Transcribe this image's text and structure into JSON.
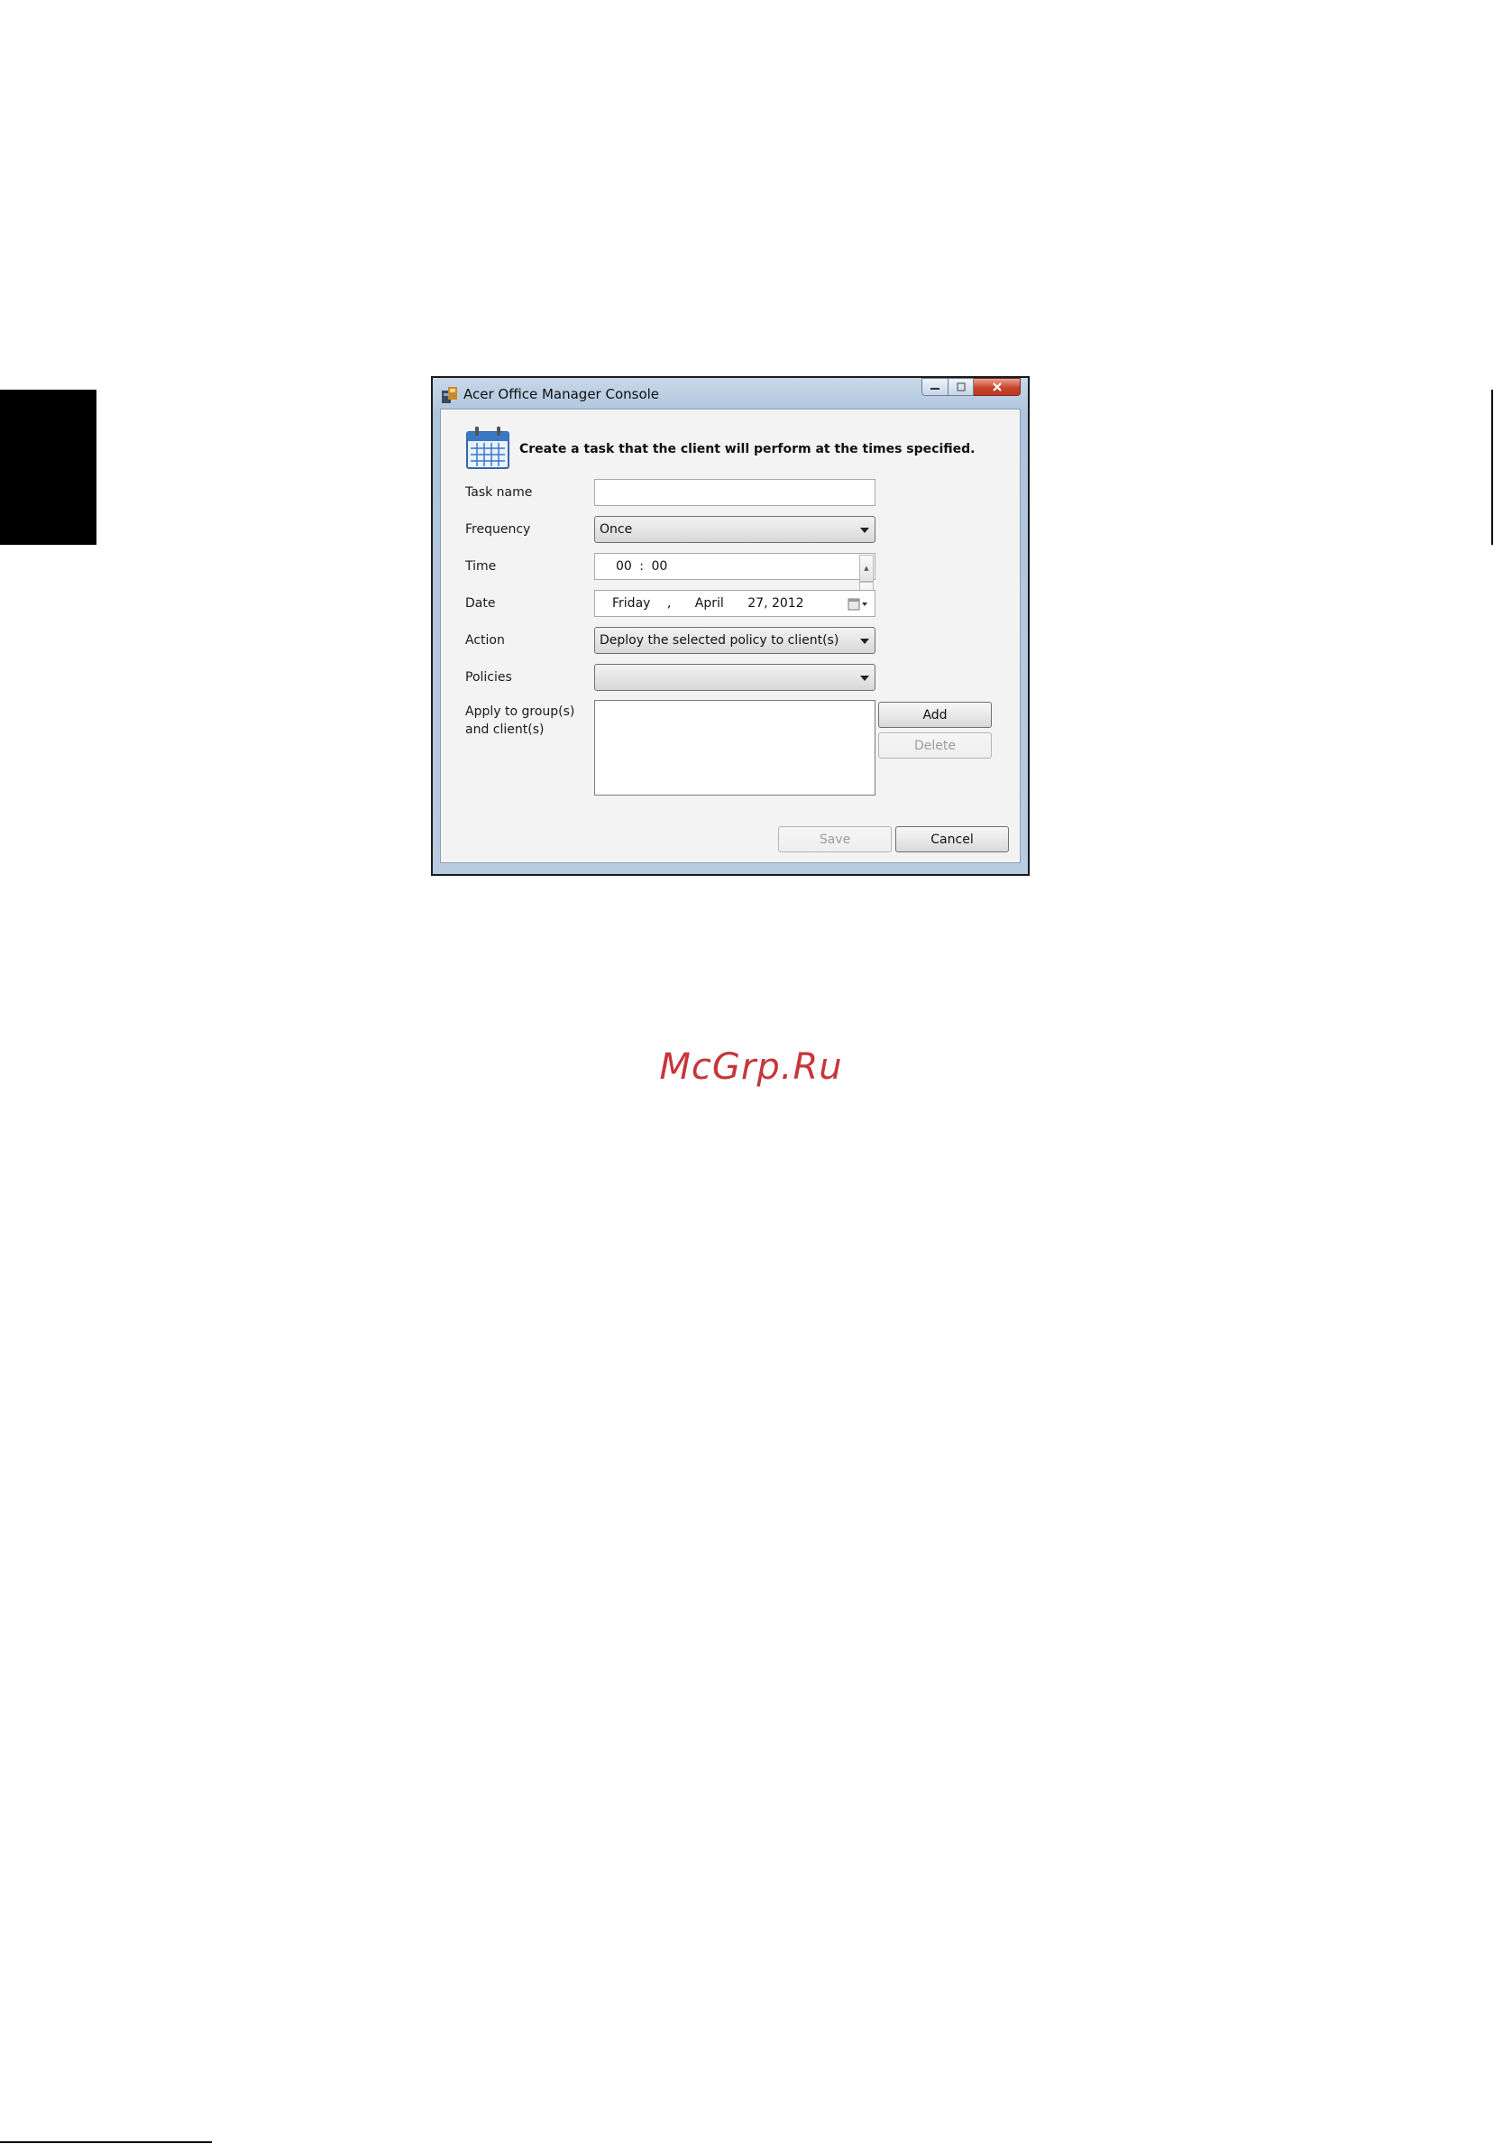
{
  "window": {
    "title": "Acer Office Manager Console",
    "header": "Create a task that the client will perform at the times specified."
  },
  "form": {
    "task_name": {
      "label": "Task name",
      "value": ""
    },
    "frequency": {
      "label": "Frequency",
      "value": "Once"
    },
    "time": {
      "label": "Time",
      "hours": "00",
      "separator": ":",
      "minutes": "00"
    },
    "date": {
      "label": "Date",
      "weekday": "Friday",
      "comma": ",",
      "month": "April",
      "day_year": "27, 2012"
    },
    "action": {
      "label": "Action",
      "value": "Deploy the selected policy to client(s)"
    },
    "policies": {
      "label": "Policies",
      "value": ""
    },
    "apply": {
      "label_line1": "Apply to group(s)",
      "label_line2": "and client(s)"
    }
  },
  "buttons": {
    "add": "Add",
    "delete": "Delete",
    "save": "Save",
    "cancel": "Cancel"
  },
  "icons": {
    "app": "acer-app-icon",
    "header": "calendar-icon",
    "date_picker": "calendar-dropdown-icon"
  },
  "watermark": "McGrp.Ru"
}
